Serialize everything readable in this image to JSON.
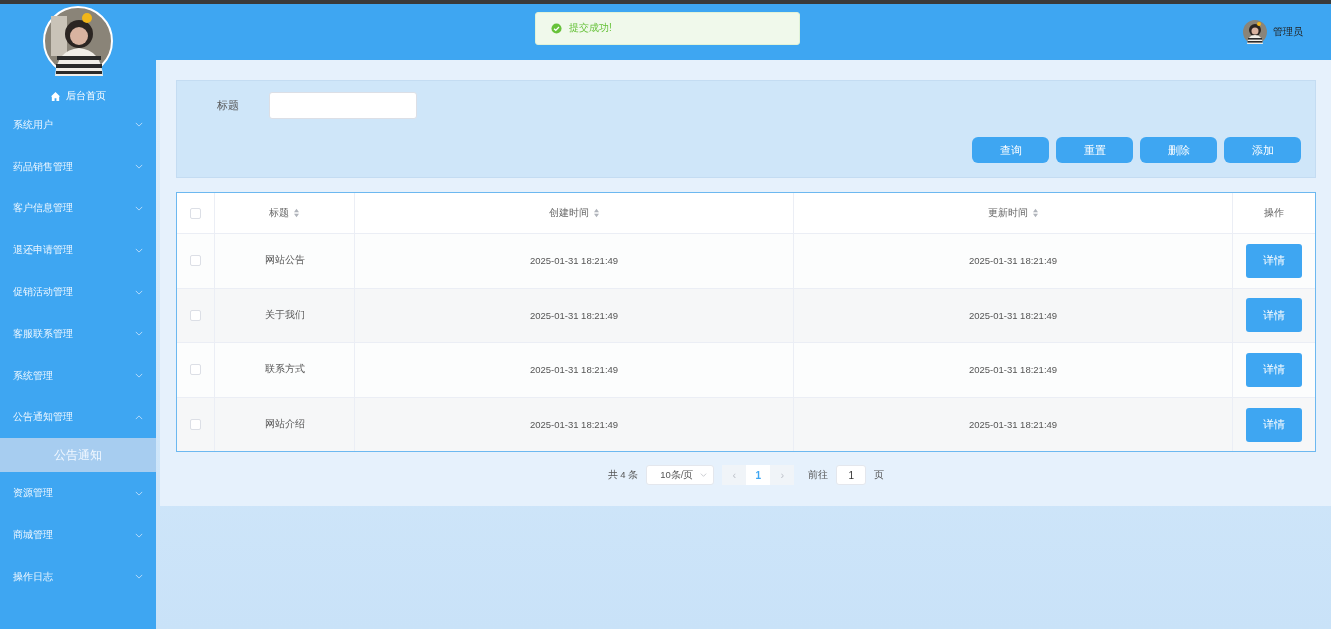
{
  "sidebar": {
    "home": "后台首页",
    "items": [
      {
        "label": "系统用户",
        "expanded": false
      },
      {
        "label": "药品销售管理",
        "expanded": false
      },
      {
        "label": "客户信息管理",
        "expanded": false
      },
      {
        "label": "退还申请管理",
        "expanded": false
      },
      {
        "label": "促销活动管理",
        "expanded": false
      },
      {
        "label": "客服联系管理",
        "expanded": false
      },
      {
        "label": "系统管理",
        "expanded": false
      },
      {
        "label": "公告通知管理",
        "expanded": true,
        "children": [
          {
            "label": "公告通知",
            "selected": true
          }
        ]
      },
      {
        "label": "资源管理",
        "expanded": false
      },
      {
        "label": "商城管理",
        "expanded": false
      },
      {
        "label": "操作日志",
        "expanded": false
      }
    ]
  },
  "header": {
    "toast": "提交成功!",
    "user": "管理员"
  },
  "search": {
    "label": "标题"
  },
  "buttons": [
    "查询",
    "重置",
    "删除",
    "添加"
  ],
  "table": {
    "header_checked": false,
    "columns": [
      {
        "label": "标题",
        "sortable": true
      },
      {
        "label": "创建时间",
        "sortable": true
      },
      {
        "label": "更新时间",
        "sortable": true
      },
      {
        "label": "操作",
        "sortable": false
      }
    ],
    "rows": [
      {
        "checked": false,
        "title": "网站公告",
        "created": "2025-01-31 18:21:49",
        "updated": "2025-01-31 18:21:49",
        "action": "详情"
      },
      {
        "checked": false,
        "title": "关于我们",
        "created": "2025-01-31 18:21:49",
        "updated": "2025-01-31 18:21:49",
        "action": "详情"
      },
      {
        "checked": false,
        "title": "联系方式",
        "created": "2025-01-31 18:21:49",
        "updated": "2025-01-31 18:21:49",
        "action": "详情"
      },
      {
        "checked": false,
        "title": "网站介绍",
        "created": "2025-01-31 18:21:49",
        "updated": "2025-01-31 18:21:49",
        "action": "详情"
      }
    ]
  },
  "pagination": {
    "total": "共 4 条",
    "page_size": "10条/页",
    "prev": "‹",
    "current": "1",
    "next": "›",
    "goto_label": "前往",
    "goto_value": "1",
    "goto_suffix": "页"
  }
}
